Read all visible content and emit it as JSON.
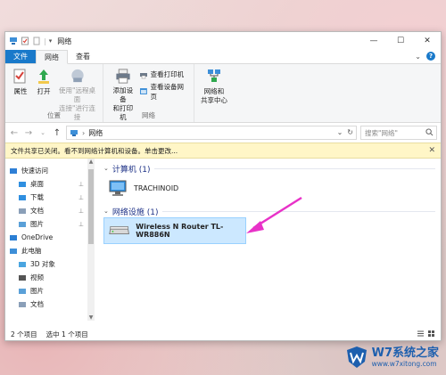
{
  "window": {
    "title": "网络",
    "qa_separator": "|",
    "controls": {
      "minimize": "—",
      "maximize": "☐",
      "close": "✕"
    }
  },
  "ribbon": {
    "tabs": [
      "文件",
      "网络",
      "查看"
    ],
    "chevron": "⌄",
    "help": "?",
    "groups": {
      "location": {
        "label": "位置",
        "buttons": [
          "属性",
          "打开",
          "使用\"远程桌面\n连接\"进行连接"
        ]
      },
      "network": {
        "label": "网络",
        "add_device": "添加设备\n和打印机",
        "view_printers": "查看打印机",
        "view_device_webpage": "查看设备网页"
      },
      "center": {
        "label": "",
        "network_center": "网络和\n共享中心"
      }
    }
  },
  "address": {
    "back": "←",
    "forward": "→",
    "recent": "⌄",
    "up": "↑",
    "sep": "›",
    "path": "网络",
    "dropdown": "⌄",
    "refresh": "↻",
    "search_placeholder": "搜索\"网络\""
  },
  "infobar": {
    "text": "文件共享已关闭。看不到网络计算机和设备。单击更改...",
    "close": "✕"
  },
  "nav": {
    "items": [
      {
        "label": "快速访问",
        "icon": "star-icon",
        "pinned": false
      },
      {
        "label": "桌面",
        "icon": "desktop-folder-icon",
        "pinned": true
      },
      {
        "label": "下载",
        "icon": "download-folder-icon",
        "pinned": true
      },
      {
        "label": "文档",
        "icon": "documents-folder-icon",
        "pinned": true
      },
      {
        "label": "图片",
        "icon": "pictures-folder-icon",
        "pinned": true
      },
      {
        "label": "OneDrive",
        "icon": "cloud-icon",
        "pinned": false
      },
      {
        "label": "此电脑",
        "icon": "computer-icon",
        "pinned": false
      },
      {
        "label": "3D 对象",
        "icon": "3d-objects-icon",
        "pinned": false
      },
      {
        "label": "视频",
        "icon": "video-folder-icon",
        "pinned": false
      },
      {
        "label": "图片",
        "icon": "pictures-folder-icon",
        "pinned": false
      },
      {
        "label": "文档",
        "icon": "documents-folder-icon",
        "pinned": false
      }
    ],
    "pin_glyph": "📌"
  },
  "content": {
    "sections": [
      {
        "title": "计算机 (1)",
        "items": [
          "TRACHINOID"
        ]
      },
      {
        "title": "网络设施 (1)",
        "items": [
          "Wireless N Router TL-WR886N"
        ]
      }
    ]
  },
  "status": {
    "count": "2 个项目",
    "selected": "选中 1 个项目"
  },
  "watermark": {
    "main": "W7系统之家",
    "sub": "www.w7xitong.com"
  },
  "colors": {
    "accent": "#1979ca",
    "selection": "#cce8ff",
    "arrow": "#e832c8",
    "infobar": "#fff6c7"
  }
}
